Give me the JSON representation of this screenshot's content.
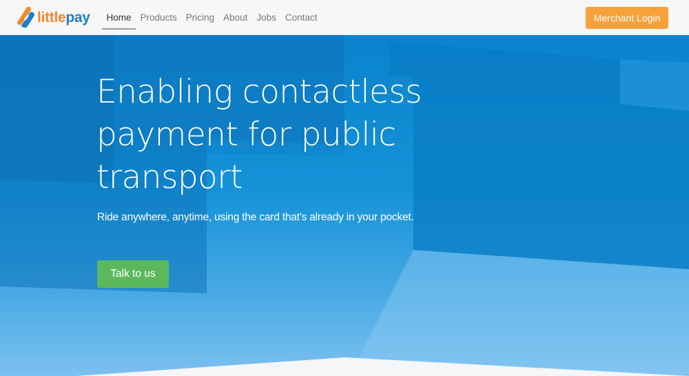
{
  "brand": {
    "logo_part1": "little",
    "logo_part2": "pay",
    "colors": {
      "orange": "#f0892b",
      "blue": "#1d7fc4"
    },
    "icon": "littlepay-logo-mark"
  },
  "nav": {
    "items": [
      {
        "label": "Home",
        "active": true
      },
      {
        "label": "Products",
        "active": false
      },
      {
        "label": "Pricing",
        "active": false
      },
      {
        "label": "About",
        "active": false
      },
      {
        "label": "Jobs",
        "active": false
      },
      {
        "label": "Contact",
        "active": false
      }
    ],
    "login_label": "Merchant Login",
    "login_color": "#f6a13a"
  },
  "hero": {
    "title": "Enabling contactless payment for public transport",
    "subtitle": "Ride anywhere, anytime, using the card that's already in your pocket.",
    "cta_label": "Talk to us",
    "cta_color": "#5cb85c",
    "background_color": "#0a83cc"
  }
}
